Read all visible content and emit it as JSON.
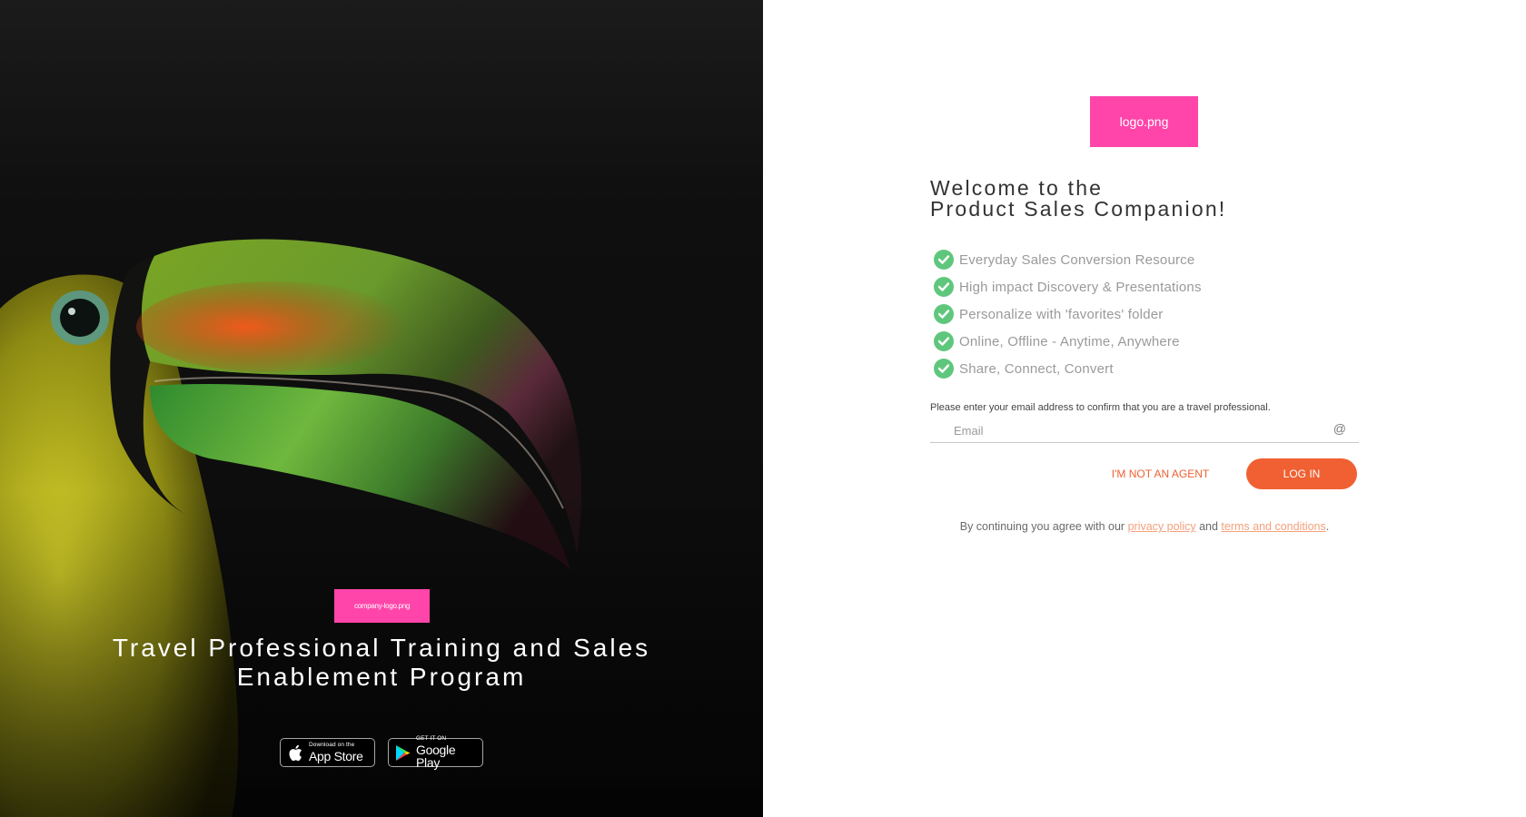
{
  "hero": {
    "company_logo_label": "company-logo.png",
    "title": "Travel Professional Training and Sales Enablement Program",
    "app_store": {
      "small": "Download on the",
      "big": "App Store"
    },
    "google_play": {
      "small": "GET IT ON",
      "big": "Google Play"
    }
  },
  "login": {
    "logo_label": "logo.png",
    "welcome_line1": "Welcome to the",
    "welcome_line2": "Product Sales Companion!",
    "features": [
      "Everyday Sales Conversion Resource",
      "High impact Discovery & Presentations",
      "Personalize with 'favorites' folder",
      "Online, Offline - Anytime, Anywhere",
      "Share, Connect, Convert"
    ],
    "instruction": "Please enter your email address to confirm that you are a travel professional.",
    "email_placeholder": "Email",
    "email_value": "",
    "at_symbol": "@",
    "not_agent_label": "I'M NOT AN AGENT",
    "login_label": "LOG IN",
    "agree_prefix": "By continuing you agree with our ",
    "privacy_label": "privacy policy",
    "agree_and": " and ",
    "terms_label": "terms and conditions",
    "agree_suffix": "."
  },
  "colors": {
    "accent": "#f06032",
    "check": "#5fc77d",
    "placeholder_logo": "#ff45aa",
    "link": "#f4a07c"
  },
  "icons": {
    "feature": "check-circle-icon",
    "email": "at-sign-icon",
    "app_store": "apple-icon",
    "google_play": "google-play-icon"
  }
}
